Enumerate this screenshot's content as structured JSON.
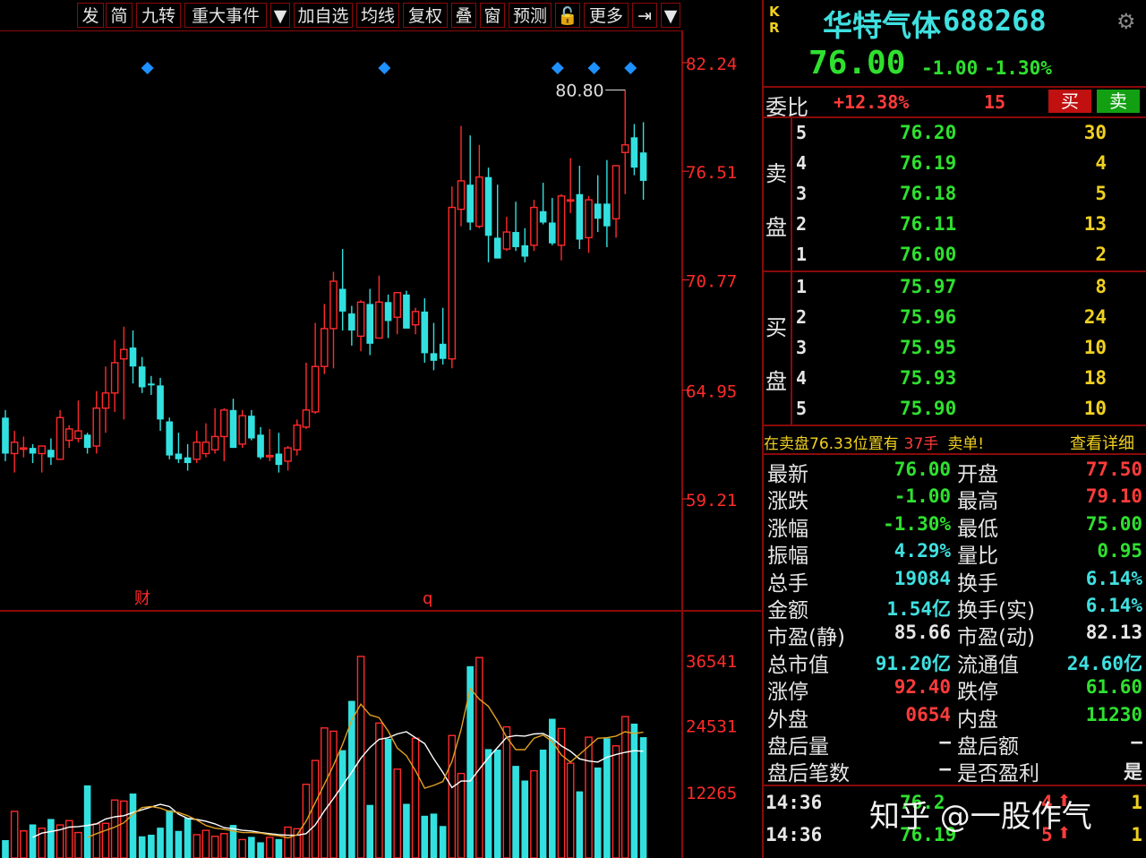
{
  "toolbar": {
    "buttons": [
      "发",
      "简",
      "九转",
      "重大事件",
      "▼",
      "加自选",
      "均线",
      "复权",
      "叠",
      "窗",
      "预测",
      "🔓",
      "更多",
      "⇥",
      "▼"
    ]
  },
  "chart": {
    "price_ticks": [
      "82.24",
      "76.51",
      "70.77",
      "64.95",
      "59.21"
    ],
    "volume_ticks": [
      "36541",
      "24531",
      "12265"
    ],
    "max_label": "80.80",
    "markers": [
      "财",
      "q"
    ],
    "colors": {
      "up": "#ff2a2a",
      "down": "#33e0e0",
      "ma1": "#ffffff",
      "ma2": "#e0a020",
      "axis": "#ff2a2a",
      "grid": "#8a0a0a"
    }
  },
  "chart_data": {
    "type": "candlestick",
    "ylim": [
      57,
      84
    ],
    "vol_ylim": [
      0,
      40000
    ],
    "candles": [
      [
        63.5,
        63.9,
        61.2,
        61.6
      ],
      [
        61.6,
        62.8,
        60.6,
        62.2
      ],
      [
        61.9,
        62.5,
        61.4,
        61.9
      ],
      [
        61.9,
        62.1,
        61.1,
        61.6
      ],
      [
        61.6,
        62.0,
        60.6,
        62.0
      ],
      [
        61.8,
        62.4,
        61.0,
        61.4
      ],
      [
        61.3,
        63.9,
        61.3,
        63.5
      ],
      [
        62.3,
        63.1,
        61.9,
        62.9
      ],
      [
        62.4,
        64.4,
        62.2,
        62.8
      ],
      [
        62.6,
        62.7,
        61.6,
        61.9
      ],
      [
        62.0,
        64.9,
        61.6,
        64.0
      ],
      [
        64.0,
        66.2,
        62.7,
        64.8
      ],
      [
        64.8,
        67.6,
        63.8,
        66.4
      ],
      [
        66.6,
        68.3,
        63.4,
        67.1
      ],
      [
        67.2,
        68.1,
        65.3,
        66.2
      ],
      [
        66.2,
        66.7,
        64.8,
        65.1
      ],
      [
        65.3,
        65.7,
        64.7,
        65.2
      ],
      [
        65.2,
        65.6,
        62.8,
        63.4
      ],
      [
        63.3,
        63.5,
        61.3,
        61.5
      ],
      [
        61.6,
        62.7,
        61.1,
        61.3
      ],
      [
        61.4,
        62.1,
        60.7,
        61.1
      ],
      [
        61.3,
        62.8,
        61.1,
        62.2
      ],
      [
        61.6,
        63.2,
        61.4,
        62.2
      ],
      [
        61.8,
        64.0,
        61.6,
        62.5
      ],
      [
        62.5,
        64.0,
        61.2,
        63.9
      ],
      [
        63.9,
        64.5,
        61.9,
        61.9
      ],
      [
        62.1,
        63.9,
        61.9,
        63.6
      ],
      [
        63.6,
        63.9,
        62.3,
        62.4
      ],
      [
        62.6,
        63.0,
        61.3,
        61.4
      ],
      [
        61.5,
        62.9,
        61.2,
        61.5
      ],
      [
        61.6,
        62.7,
        60.6,
        61.0
      ],
      [
        61.2,
        62.0,
        60.7,
        61.9
      ],
      [
        61.8,
        63.4,
        61.5,
        63.1
      ],
      [
        63.0,
        66.4,
        62.9,
        63.9
      ],
      [
        63.8,
        68.5,
        63.7,
        66.2
      ],
      [
        66.2,
        69.5,
        65.8,
        68.2
      ],
      [
        68.2,
        71.2,
        66.1,
        70.7
      ],
      [
        70.3,
        72.4,
        68.1,
        69.1
      ],
      [
        69.0,
        69.4,
        67.3,
        68.1
      ],
      [
        67.8,
        69.7,
        67.0,
        69.6
      ],
      [
        69.5,
        70.3,
        66.8,
        67.4
      ],
      [
        67.7,
        71.0,
        67.7,
        69.6
      ],
      [
        69.6,
        70.0,
        67.7,
        68.6
      ],
      [
        68.8,
        70.1,
        67.9,
        70.1
      ],
      [
        70.0,
        70.2,
        68.3,
        68.2
      ],
      [
        68.4,
        69.3,
        67.9,
        69.1
      ],
      [
        69.1,
        69.8,
        66.4,
        66.9
      ],
      [
        66.9,
        68.5,
        66.0,
        66.5
      ],
      [
        67.4,
        69.3,
        66.3,
        66.6
      ],
      [
        66.6,
        75.7,
        66.1,
        74.6
      ],
      [
        74.5,
        78.9,
        73.6,
        76.0
      ],
      [
        75.8,
        78.4,
        73.4,
        73.8
      ],
      [
        73.6,
        77.9,
        73.5,
        76.2
      ],
      [
        76.2,
        76.7,
        71.7,
        73.1
      ],
      [
        73.0,
        75.8,
        71.9,
        71.9
      ],
      [
        72.4,
        74.1,
        72.3,
        73.3
      ],
      [
        73.3,
        74.9,
        72.3,
        72.5
      ],
      [
        72.6,
        73.5,
        71.7,
        72.0
      ],
      [
        72.6,
        75.0,
        72.3,
        74.6
      ],
      [
        74.4,
        75.9,
        73.7,
        73.8
      ],
      [
        73.8,
        75.1,
        72.6,
        72.7
      ],
      [
        72.6,
        75.3,
        71.8,
        75.2
      ],
      [
        75.0,
        77.2,
        74.3,
        75.0
      ],
      [
        75.3,
        76.8,
        72.4,
        72.9
      ],
      [
        73.0,
        75.2,
        72.2,
        75.0
      ],
      [
        74.8,
        76.3,
        73.3,
        74.0
      ],
      [
        74.8,
        77.1,
        72.5,
        73.6
      ],
      [
        74.0,
        76.8,
        73.0,
        76.8
      ],
      [
        77.5,
        80.8,
        75.3,
        77.9
      ],
      [
        78.3,
        79.0,
        76.3,
        76.7
      ],
      [
        77.5,
        79.1,
        75.0,
        76.0
      ]
    ],
    "volumes": [
      3300,
      8600,
      5000,
      6200,
      5500,
      7200,
      6100,
      6900,
      4700,
      13400,
      6300,
      6400,
      10700,
      10500,
      11900,
      4000,
      4300,
      5600,
      8800,
      5000,
      7400,
      4300,
      5100,
      4000,
      4500,
      6100,
      3400,
      3900,
      2900,
      3800,
      3500,
      5700,
      5400,
      13600,
      18000,
      24000,
      23400,
      19900,
      29000,
      37200,
      9800,
      24900,
      22000,
      16400,
      10000,
      22100,
      7800,
      8200,
      5900,
      22600,
      15600,
      35400,
      37000,
      20100,
      20000,
      24200,
      17000,
      14300,
      16100,
      20000,
      25700,
      23900,
      17500,
      12300,
      22300,
      16700,
      22100,
      20700,
      26100,
      24800,
      22300
    ],
    "ma_price_1": [],
    "ma_vol_1": [
      3800,
      4600,
      4900,
      5200,
      5700,
      5800,
      6000,
      6300,
      7200,
      7600,
      7800,
      8400,
      8900,
      9400,
      9900,
      9500,
      8100,
      7300,
      7100,
      6800,
      6300,
      5600,
      5400,
      5100,
      5000,
      4700,
      4500,
      4300,
      4200,
      4200,
      4500,
      6100,
      8700,
      11000,
      13400,
      15800,
      18400,
      20400,
      21900,
      22200,
      22900,
      23300,
      22200,
      21100,
      18300,
      15800,
      13000,
      14200,
      14200,
      16400,
      18500,
      20400,
      22300,
      22600,
      22500,
      22900,
      23000,
      22100,
      20700,
      19700,
      18300,
      17900,
      17700,
      18600,
      19100,
      19500,
      19800,
      19700
    ],
    "ma_vol_2": [
      3800,
      4500,
      5100,
      5700,
      6500,
      8100,
      9300,
      9500,
      9200,
      8600,
      8400,
      7800,
      7000,
      6000,
      5500,
      5300,
      5000,
      4700,
      4700,
      4600,
      4300,
      4100,
      3700,
      4300,
      6800,
      10200,
      13600,
      17100,
      21000,
      25400,
      28400,
      26400,
      25900,
      23400,
      20300,
      18900,
      16100,
      12900,
      13400,
      14100,
      17800,
      23700,
      31300,
      29300,
      28000,
      25300,
      22300,
      20000,
      20000,
      22100,
      22700,
      21500,
      19000,
      17700,
      19100,
      20600,
      22100,
      22200,
      22500,
      23300,
      23000,
      23200
    ]
  },
  "quote": {
    "kr": "KR",
    "name": "华特气体",
    "code": "688268",
    "price": "76.00",
    "change": "-1.00",
    "change_pct": "-1.30%",
    "weibi_label": "委比",
    "weibi": "+12.38%",
    "weicha": "15",
    "buy_btn": "买",
    "sell_btn": "卖",
    "sell_label_1": "卖",
    "sell_label_2": "盘",
    "buy_label_1": "买",
    "buy_label_2": "盘",
    "asks": [
      {
        "lvl": "5",
        "price": "76.20",
        "vol": "30"
      },
      {
        "lvl": "4",
        "price": "76.19",
        "vol": "4"
      },
      {
        "lvl": "3",
        "price": "76.18",
        "vol": "5"
      },
      {
        "lvl": "2",
        "price": "76.11",
        "vol": "13"
      },
      {
        "lvl": "1",
        "price": "76.00",
        "vol": "2"
      }
    ],
    "bids": [
      {
        "lvl": "1",
        "price": "75.97",
        "vol": "8"
      },
      {
        "lvl": "2",
        "price": "75.96",
        "vol": "24"
      },
      {
        "lvl": "3",
        "price": "75.95",
        "vol": "10"
      },
      {
        "lvl": "4",
        "price": "75.93",
        "vol": "18"
      },
      {
        "lvl": "5",
        "price": "75.90",
        "vol": "10"
      }
    ],
    "notice_a": "在卖盘76.33位置有",
    "notice_b": "37手",
    "notice_c": "卖单!",
    "notice_link": "查看详细",
    "stats": [
      {
        "l1": "最新",
        "v1": "76.00",
        "c1": "g",
        "l2": "开盘",
        "v2": "77.50",
        "c2": "r"
      },
      {
        "l1": "涨跌",
        "v1": "-1.00",
        "c1": "g",
        "l2": "最高",
        "v2": "79.10",
        "c2": "r"
      },
      {
        "l1": "涨幅",
        "v1": "-1.30%",
        "c1": "g",
        "l2": "最低",
        "v2": "75.00",
        "c2": "g"
      },
      {
        "l1": "振幅",
        "v1": "4.29%",
        "c1": "c",
        "l2": "量比",
        "v2": "0.95",
        "c2": "g"
      },
      {
        "l1": "总手",
        "v1": "19084",
        "c1": "c",
        "l2": "换手",
        "v2": "6.14%",
        "c2": "c"
      },
      {
        "l1": "金额",
        "v1": "1.54亿",
        "c1": "c",
        "l2": "换手(实)",
        "v2": "6.14%",
        "c2": "c"
      },
      {
        "l1": "市盈(静)",
        "v1": "85.66",
        "c1": "w",
        "l2": "市盈(动)",
        "v2": "82.13",
        "c2": "w"
      },
      {
        "l1": "总市值",
        "v1": "91.20亿",
        "c1": "c",
        "l2": "流通值",
        "v2": "24.60亿",
        "c2": "c"
      },
      {
        "l1": "涨停",
        "v1": "92.40",
        "c1": "r",
        "l2": "跌停",
        "v2": "61.60",
        "c2": "g"
      },
      {
        "l1": "外盘",
        "v1": "0654",
        "c1": "r",
        "l2": "内盘",
        "v2": "11230",
        "c2": "g"
      },
      {
        "l1": "盘后量",
        "v1": "—",
        "c1": "w",
        "l2": "盘后额",
        "v2": "—",
        "c2": "w"
      },
      {
        "l1": "盘后笔数",
        "v1": "—",
        "c1": "w",
        "l2": "是否盈利",
        "v2": "是",
        "c2": "w"
      }
    ],
    "ticks": [
      {
        "time": "14:36",
        "price": "76.2",
        "vol": "4",
        "n": "1"
      },
      {
        "time": "14:36",
        "price": "76.19",
        "vol": "5",
        "n": "1"
      }
    ],
    "watermark": "知乎 @一股作气"
  }
}
